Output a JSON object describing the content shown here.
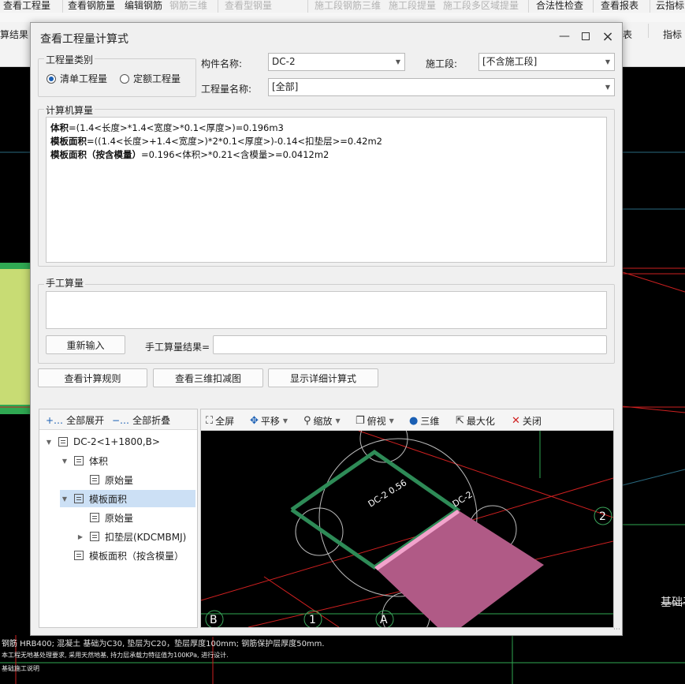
{
  "ribbon": {
    "row1": [
      {
        "label": "查看工程量",
        "dim": false
      },
      {
        "label": "查看钢筋量",
        "dim": false
      },
      {
        "label": "编辑钢筋",
        "dim": false
      },
      {
        "label": "钢筋三维",
        "dim": true
      },
      {
        "label": "查看型钢量",
        "dim": true
      },
      {
        "label": "施工段钢筋三维",
        "dim": true
      },
      {
        "label": "施工段提量",
        "dim": true
      },
      {
        "label": "施工段多区域提量",
        "dim": true
      },
      {
        "label": "合法性检查",
        "dim": false
      },
      {
        "label": "查看报表",
        "dim": false
      },
      {
        "label": "云指标",
        "dim": false
      }
    ],
    "row2": [
      {
        "label": "算结果"
      },
      {
        "label": "表"
      },
      {
        "label": "指标"
      }
    ]
  },
  "cad": {
    "axis_labels": [
      "2"
    ],
    "side_text": "基础平",
    "notes": [
      "钢筋  HRB400;  混凝土  基础为C30,  垫层为C20，垫层厚度100mm;  钢筋保护层厚度50mm.",
      "本工程无地基处理要求, 采用天然地基, 持力层承载力特征值为100KPa, 进行设计.",
      "基础施工说明"
    ]
  },
  "dialog": {
    "title": "查看工程量计算式",
    "quantity_type": {
      "legend": "工程量类别",
      "options": [
        "清单工程量",
        "定额工程量"
      ],
      "selected": 0
    },
    "component_label": "构件名称:",
    "component_value": "DC-2",
    "stage_label": "施工段:",
    "stage_value": "[不含施工段]",
    "quantity_name_label": "工程量名称:",
    "quantity_name_value": "[全部]",
    "computer_section": "计算机算量",
    "formulas": [
      {
        "name": "体积",
        "expr": "=(1.4<长度>*1.4<宽度>*0.1<厚度>)=0.196m3"
      },
      {
        "name": "模板面积",
        "expr": "=((1.4<长度>+1.4<宽度>)*2*0.1<厚度>)-0.14<扣垫层>=0.42m2"
      },
      {
        "name": "模板面积（按含模量）",
        "expr": "=0.196<体积>*0.21<含模量>=0.0412m2"
      }
    ],
    "manual_section": "手工算量",
    "reinput_button": "重新输入",
    "manual_result_label": "手工算量结果=",
    "manual_result_value": "",
    "buttons": {
      "rules": "查看计算规则",
      "deduct_3d": "查看三维扣减图",
      "details": "显示详细计算式"
    },
    "tree_toolbar": {
      "expand": "全部展开",
      "collapse": "全部折叠"
    },
    "tree": [
      {
        "label": "DC-2<1+1800,B>",
        "level": 0,
        "expander": "down",
        "selected": false
      },
      {
        "label": "体积",
        "level": 1,
        "expander": "down",
        "selected": false
      },
      {
        "label": "原始量",
        "level": 2,
        "expander": "",
        "selected": false
      },
      {
        "label": "模板面积",
        "level": 1,
        "expander": "down",
        "selected": true
      },
      {
        "label": "原始量",
        "level": 2,
        "expander": "",
        "selected": false
      },
      {
        "label": "扣垫层(KDCMBMJ)",
        "level": 2,
        "expander": "right",
        "selected": false
      },
      {
        "label": "模板面积（按含模量）",
        "level": 1,
        "expander": "",
        "selected": false
      }
    ],
    "view_toolbar": [
      {
        "label": "全屏",
        "icon": "fullscreen-icon",
        "caret": false
      },
      {
        "label": "平移",
        "icon": "pan-icon",
        "caret": true
      },
      {
        "label": "缩放",
        "icon": "zoom-icon",
        "caret": true
      },
      {
        "label": "俯视",
        "icon": "top-view-icon",
        "caret": true
      },
      {
        "label": "三维",
        "icon": "3d-icon",
        "caret": false
      },
      {
        "label": "最大化",
        "icon": "maximize-icon",
        "caret": false
      },
      {
        "label": "关闭",
        "icon": "close-icon",
        "caret": false
      }
    ],
    "view3d": {
      "labels": {
        "dim": "DC-2 0.56",
        "name": "DC-2"
      },
      "axis_labels": [
        "B",
        "1",
        "A",
        "2"
      ]
    }
  }
}
